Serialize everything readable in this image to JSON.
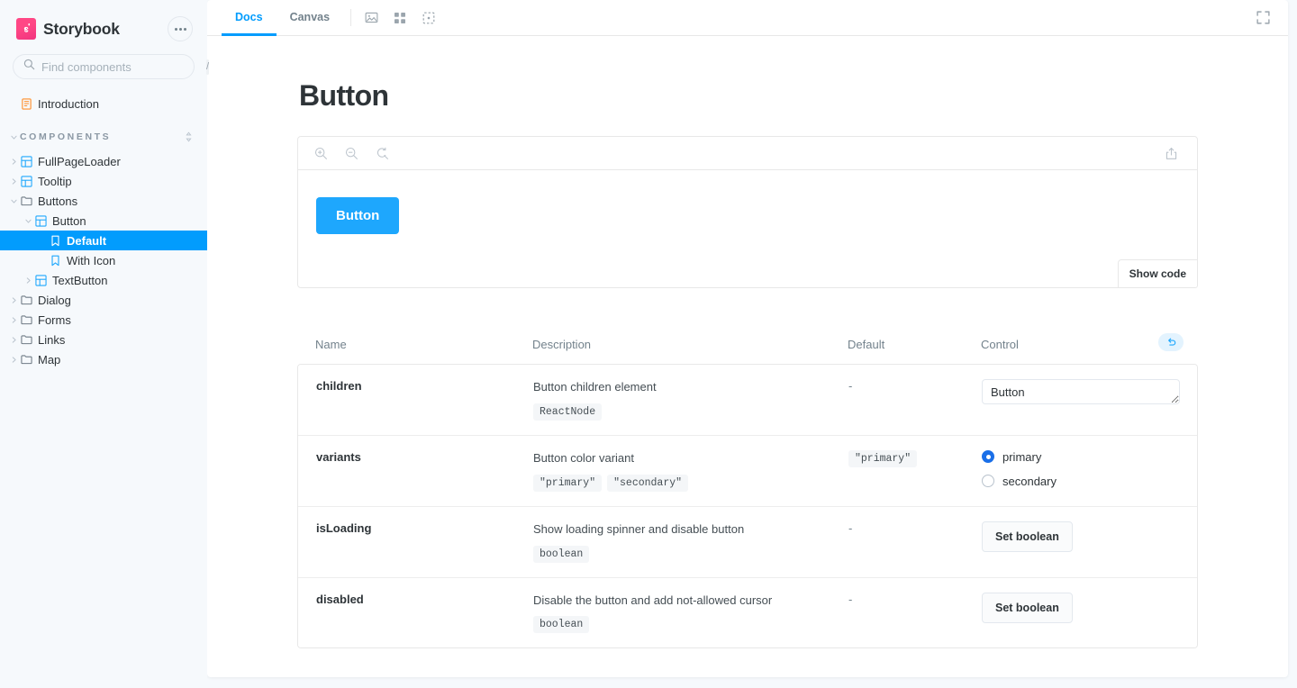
{
  "sidebar": {
    "brand": {
      "name": "Storybook",
      "logo_icon": "storybook-logo-icon"
    },
    "menu_button_icon": "ellipsis-icon",
    "search": {
      "placeholder": "Find components",
      "value": "",
      "icon": "search-icon",
      "shortcut": "/"
    },
    "intro": {
      "label": "Introduction",
      "icon": "document-icon"
    },
    "section": {
      "title": "COMPONENTS",
      "sort_icon": "sort-icon",
      "caret_icon": "caret-down-icon"
    },
    "tree": [
      {
        "label": "FullPageLoader",
        "icon": "component-grid-icon",
        "depth": 0,
        "caret": "right",
        "selected": false
      },
      {
        "label": "Tooltip",
        "icon": "component-grid-icon",
        "depth": 0,
        "caret": "right",
        "selected": false
      },
      {
        "label": "Buttons",
        "icon": "folder-icon",
        "depth": 0,
        "caret": "down",
        "selected": false
      },
      {
        "label": "Button",
        "icon": "component-grid-icon",
        "depth": 1,
        "caret": "down",
        "selected": false
      },
      {
        "label": "Default",
        "icon": "story-bookmark-icon",
        "depth": 2,
        "caret": "none",
        "selected": true
      },
      {
        "label": "With Icon",
        "icon": "story-bookmark-icon",
        "depth": 2,
        "caret": "none",
        "selected": false
      },
      {
        "label": "TextButton",
        "icon": "component-grid-icon",
        "depth": 1,
        "caret": "right",
        "selected": false
      },
      {
        "label": "Dialog",
        "icon": "folder-icon",
        "depth": 0,
        "caret": "right",
        "selected": false
      },
      {
        "label": "Forms",
        "icon": "folder-icon",
        "depth": 0,
        "caret": "right",
        "selected": false
      },
      {
        "label": "Links",
        "icon": "folder-icon",
        "depth": 0,
        "caret": "right",
        "selected": false
      },
      {
        "label": "Map",
        "icon": "folder-icon",
        "depth": 0,
        "caret": "right",
        "selected": false
      }
    ]
  },
  "toolbar": {
    "tabs": [
      {
        "label": "Docs",
        "active": true
      },
      {
        "label": "Canvas",
        "active": false
      }
    ],
    "icons": [
      "image-icon",
      "grid-icon",
      "measure-icon"
    ],
    "fullscreen_icon": "fullscreen-icon"
  },
  "doc": {
    "title": "Button",
    "preview": {
      "zoom_in_icon": "zoom-in-icon",
      "zoom_out_icon": "zoom-out-icon",
      "zoom_reset_icon": "zoom-reset-icon",
      "share_icon": "share-icon",
      "demo_button_label": "Button",
      "show_code_label": "Show code"
    },
    "table": {
      "headers": {
        "name": "Name",
        "description": "Description",
        "default": "Default",
        "control": "Control"
      },
      "reset_icon": "reset-undo-icon",
      "rows": [
        {
          "name": "children",
          "description": "Button children element",
          "types": [
            "ReactNode"
          ],
          "default": "-",
          "default_is_chip": false,
          "control": {
            "kind": "text",
            "value": "Button"
          }
        },
        {
          "name": "variants",
          "description": "Button color variant",
          "types": [
            "\"primary\"",
            "\"secondary\""
          ],
          "default": "\"primary\"",
          "default_is_chip": true,
          "control": {
            "kind": "radio",
            "options": [
              {
                "label": "primary",
                "selected": true
              },
              {
                "label": "secondary",
                "selected": false
              }
            ]
          }
        },
        {
          "name": "isLoading",
          "description": "Show loading spinner and disable button",
          "types": [
            "boolean"
          ],
          "default": "-",
          "default_is_chip": false,
          "control": {
            "kind": "button",
            "label": "Set boolean"
          }
        },
        {
          "name": "disabled",
          "description": "Disable the button and add not-allowed cursor",
          "types": [
            "boolean"
          ],
          "default": "-",
          "default_is_chip": false,
          "control": {
            "kind": "button",
            "label": "Set boolean"
          }
        }
      ]
    }
  },
  "colors": {
    "accent": "#029CFD",
    "demo_button": "#1EA7FD",
    "brand_pink": "#FF4785",
    "app_bg": "#F6F9FC",
    "radio_blue": "#1A6FE8"
  }
}
